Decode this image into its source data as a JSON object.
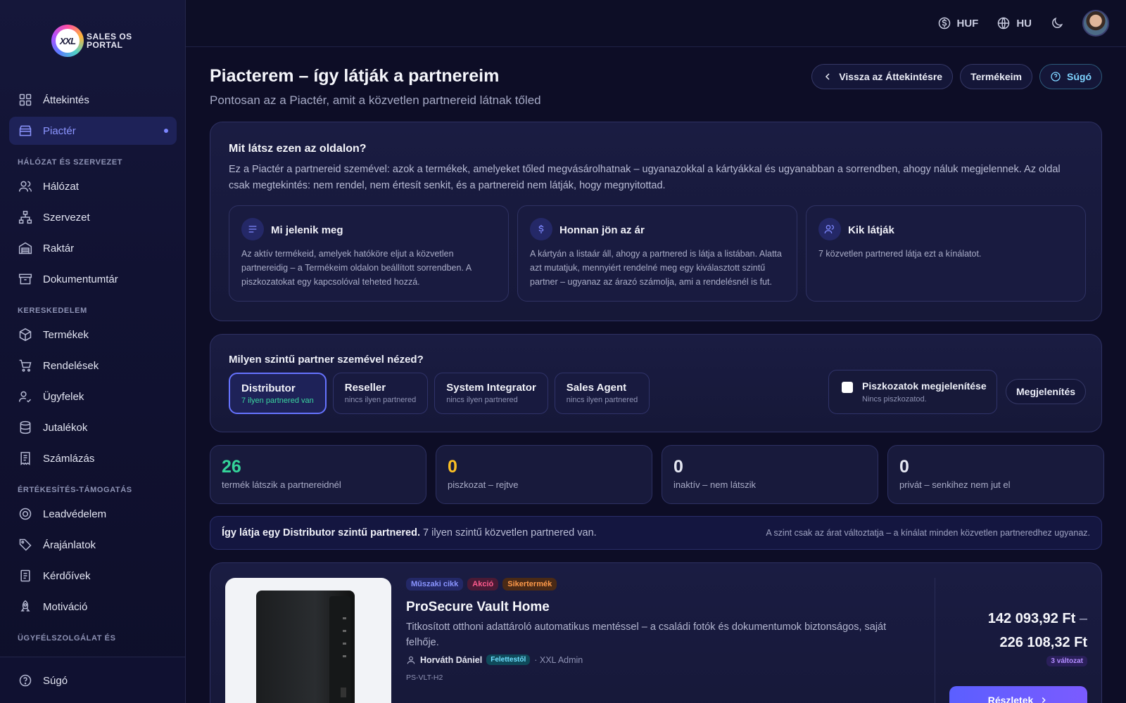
{
  "logo": {
    "mark": "XXL",
    "text": "SALES OS PORTAL"
  },
  "topbar": {
    "currency": "HUF",
    "language": "HU"
  },
  "sidebar": {
    "top_items": [
      {
        "label": "Áttekintés"
      },
      {
        "label": "Piactér"
      }
    ],
    "sections": [
      {
        "title": "HÁLÓZAT ÉS SZERVEZET",
        "items": [
          {
            "label": "Hálózat"
          },
          {
            "label": "Szervezet"
          },
          {
            "label": "Raktár"
          },
          {
            "label": "Dokumentumtár"
          }
        ]
      },
      {
        "title": "KERESKEDELEM",
        "items": [
          {
            "label": "Termékek"
          },
          {
            "label": "Rendelések"
          },
          {
            "label": "Ügyfelek"
          },
          {
            "label": "Jutalékok"
          },
          {
            "label": "Számlázás"
          }
        ]
      },
      {
        "title": "ÉRTÉKESÍTÉS-TÁMOGATÁS",
        "items": [
          {
            "label": "Leadvédelem"
          },
          {
            "label": "Árajánlatok"
          },
          {
            "label": "Kérdőívek"
          },
          {
            "label": "Motiváció"
          }
        ]
      },
      {
        "title": "ÜGYFÉLSZOLGÁLAT ÉS"
      }
    ],
    "bottom_item": {
      "label": "Súgó"
    }
  },
  "header": {
    "title": "Piacterem – így látják a partnereim",
    "subtitle": "Pontosan az a Piactér, amit a közvetlen partnereid látnak tőled",
    "back_btn": "Vissza az Áttekintésre",
    "products_btn": "Termékeim",
    "help_btn": "Súgó"
  },
  "info": {
    "title": "Mit látsz ezen az oldalon?",
    "text": "Ez a Piactér a partnereid szemével: azok a termékek, amelyeket tőled megvásárolhatnak – ugyanazokkal a kártyákkal és ugyanabban a sorrendben, ahogy náluk megjelennek. Az oldal csak megtekintés: nem rendel, nem értesít senkit, és a partnereid nem látják, hogy megnyitottad.",
    "cards": [
      {
        "title": "Mi jelenik meg",
        "text": "Az aktív termékeid, amelyek hatóköre eljut a közvetlen partnereidig – a Termékeim oldalon beállított sorrendben. A piszkozatokat egy kapcsolóval teheted hozzá."
      },
      {
        "title": "Honnan jön az ár",
        "text": "A kártyán a listaár áll, ahogy a partnered is látja a listában. Alatta azt mutatjuk, mennyiért rendelné meg egy kiválasztott szintű partner – ugyanaz az árazó számolja, ami a rendelésnél is fut."
      },
      {
        "title": "Kik látják",
        "text": "7 közvetlen partnered látja ezt a kínálatot."
      }
    ]
  },
  "level": {
    "title": "Milyen szintű partner szemével nézed?",
    "options": [
      {
        "name": "Distributor",
        "sub": "7 ilyen partnered van"
      },
      {
        "name": "Reseller",
        "sub": "nincs ilyen partnered"
      },
      {
        "name": "System Integrator",
        "sub": "nincs ilyen partnered"
      },
      {
        "name": "Sales Agent",
        "sub": "nincs ilyen partnered"
      }
    ],
    "drafts_label": "Piszkozatok megjelenítése",
    "drafts_sub": "Nincs piszkozatod.",
    "show_btn": "Megjelenítés"
  },
  "stats": [
    {
      "value": "26",
      "label": "termék látszik a partnereidnél",
      "color": "#34d399"
    },
    {
      "value": "0",
      "label": "piszkozat – rejtve",
      "color": "#fbbf24"
    },
    {
      "value": "0",
      "label": "inaktív – nem látszik",
      "color": "#e5e7f2"
    },
    {
      "value": "0",
      "label": "privát – senkihez nem jut el",
      "color": "#e5e7f2"
    }
  ],
  "note": {
    "bold": "Így látja egy Distributor szintű partnered.",
    "text": " 7 ilyen szintű közvetlen partnered van.",
    "right": "A szint csak az árat változtatja – a kínálat minden közvetlen partneredhez ugyanaz."
  },
  "product": {
    "tags": [
      "Műszaki cikk",
      "Akció",
      "Sikertermék"
    ],
    "name": "ProSecure Vault Home",
    "desc": "Titkosított otthoni adattároló automatikus mentéssel – a családi fotók és dokumentumok biztonságos, saját felhője.",
    "owner": "Horváth Dániel",
    "owner_badge": "Felettestől",
    "owner_suffix": "· XXL Admin",
    "sku": "PS-VLT-H2",
    "price_from": "142 093,92 Ft",
    "price_to": "226 108,32 Ft",
    "variants": "3 változat",
    "details_btn": "Részletek"
  }
}
